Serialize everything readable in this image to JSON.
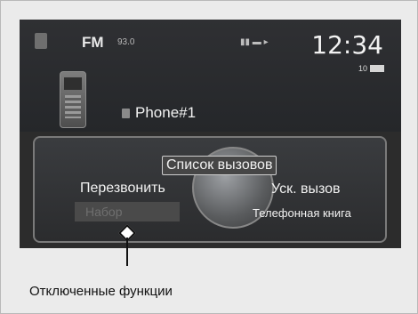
{
  "status_bar": {
    "band": "FM",
    "frequency_info": "93.0",
    "clock": "12:34",
    "subwoofer_level": "10"
  },
  "phone": {
    "name": "Phone#1"
  },
  "menu": {
    "call_list": "Список вызовов",
    "redial": "Перезвонить",
    "speed_dial": "Уск. вызов",
    "dial": "Набор",
    "phonebook": "Телефонная книга"
  },
  "callout": {
    "label": "Отключенные функции"
  },
  "icons": [
    "phone-badge-icon",
    "cellphone-icon",
    "phone-small-icon",
    "bluetooth-icon",
    "signal-icon"
  ]
}
